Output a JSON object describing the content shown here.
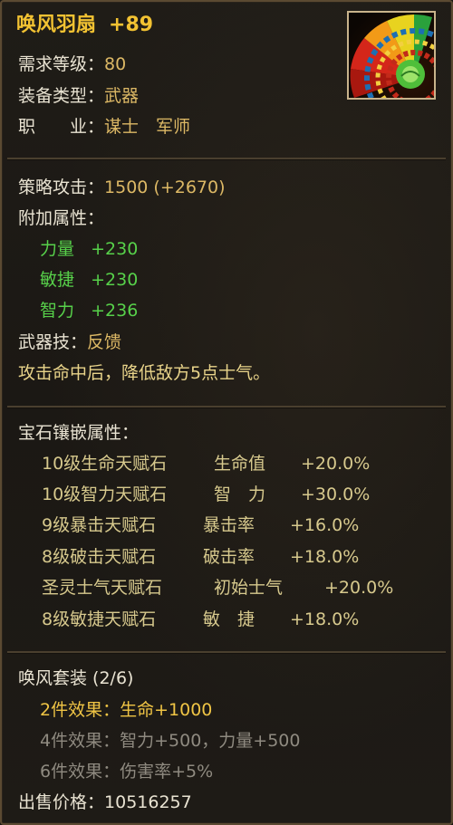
{
  "item": {
    "name": "唤风羽扇",
    "enhance": "+89",
    "icon": "feather-fan-icon"
  },
  "requirements": [
    {
      "label": "需求等级：",
      "value": "80"
    },
    {
      "label": "装备类型：",
      "value": "武器"
    },
    {
      "label": "职　　业：",
      "value": "谋士　军师"
    }
  ],
  "attack": {
    "label": "策略攻击：",
    "value": "1500 (+2670)"
  },
  "bonus": {
    "label": "附加属性：",
    "stats": [
      {
        "name": "力量",
        "value": "+230"
      },
      {
        "name": "敏捷",
        "value": "+230"
      },
      {
        "name": "智力",
        "value": "+236"
      }
    ]
  },
  "skill": {
    "label": "武器技：",
    "name": "反馈",
    "desc": "攻击命中后，降低敌方5点士气。"
  },
  "gems": {
    "label": "宝石镶嵌属性：",
    "items": [
      {
        "stone": "10级生命天赋石",
        "stat": "生命值",
        "value": "+20.0%"
      },
      {
        "stone": "10级智力天赋石",
        "stat": "智　力",
        "value": "+30.0%"
      },
      {
        "stone": "9级暴击天赋石",
        "stat": "暴击率",
        "value": "+16.0%"
      },
      {
        "stone": "8级破击天赋石",
        "stat": "破击率",
        "value": "+18.0%"
      },
      {
        "stone": "圣灵士气天赋石",
        "stat": "初始士气",
        "value": "+20.0%"
      },
      {
        "stone": "8级敏捷天赋石",
        "stat": "敏　捷",
        "value": "+18.0%"
      }
    ]
  },
  "set": {
    "name": "唤风套装 (2/6)",
    "effects": [
      {
        "label": "2件效果：",
        "value": "生命+1000",
        "active": true
      },
      {
        "label": "4件效果：",
        "value": "智力+500，力量+500",
        "active": false
      },
      {
        "label": "6件效果：",
        "value": "伤害率+5%",
        "active": false
      }
    ]
  },
  "price": {
    "label": "出售价格：",
    "value": "10516257"
  },
  "colors": {
    "name": "#f2c232",
    "green": "#57d14a",
    "inactive": "#8f8a80",
    "border": "#5b4a32"
  }
}
